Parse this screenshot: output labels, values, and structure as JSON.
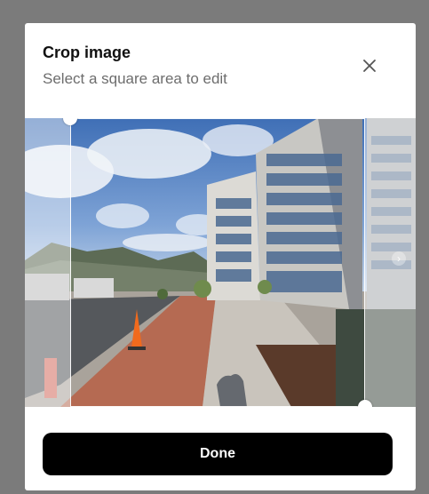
{
  "dialog": {
    "title": "Crop image",
    "subtitle": "Select a square area to edit",
    "close_icon": "close-icon",
    "done_label": "Done"
  },
  "photo": {
    "description_icon": "image",
    "handle_icons": [
      "resize-handle-top-left",
      "resize-handle-bottom-right"
    ],
    "scroll_icon": "chevron-right-icon"
  },
  "colors": {
    "overlay_backdrop": "#7b7b7b",
    "dialog_bg": "#ffffff",
    "button_bg": "#000000",
    "button_text": "#ffffff",
    "subtitle_text": "#6d6d6d"
  }
}
